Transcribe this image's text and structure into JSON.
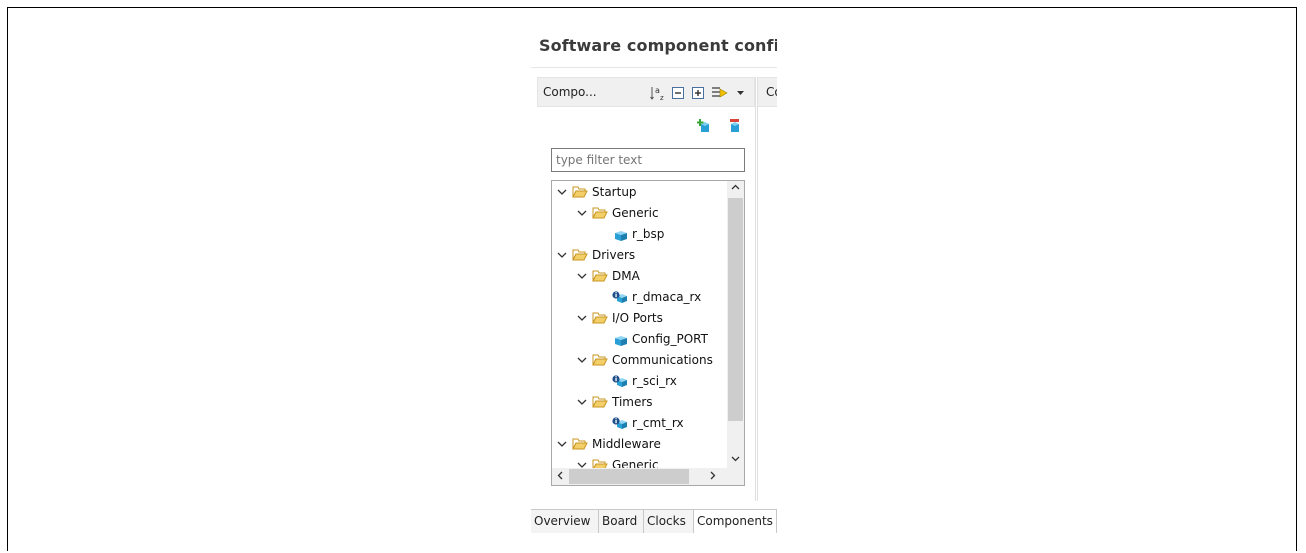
{
  "panel": {
    "title": "Software component confi",
    "left_view_title": "Compo...",
    "right_view_title": "Co"
  },
  "filter": {
    "placeholder": "type filter text",
    "value": ""
  },
  "tree": [
    {
      "label": "Startup",
      "type": "folder",
      "expanded": true
    },
    {
      "label": "Generic",
      "type": "folder",
      "expanded": true
    },
    {
      "label": "r_bsp",
      "type": "component"
    },
    {
      "label": "Drivers",
      "type": "folder",
      "expanded": true
    },
    {
      "label": "DMA",
      "type": "folder",
      "expanded": true
    },
    {
      "label": "r_dmaca_rx",
      "type": "component-info"
    },
    {
      "label": "I/O Ports",
      "type": "folder",
      "expanded": true
    },
    {
      "label": "Config_PORT",
      "type": "component"
    },
    {
      "label": "Communications",
      "type": "folder",
      "expanded": true
    },
    {
      "label": "r_sci_rx",
      "type": "component-info"
    },
    {
      "label": "Timers",
      "type": "folder",
      "expanded": true
    },
    {
      "label": "r_cmt_rx",
      "type": "component-info"
    },
    {
      "label": "Middleware",
      "type": "folder",
      "expanded": true
    },
    {
      "label": "Generic",
      "type": "folder",
      "expanded": true
    }
  ],
  "tabs": [
    "Overview",
    "Board",
    "Clocks",
    "Components"
  ],
  "active_tab": "Components",
  "toolbar_icons": [
    "sort-az-icon",
    "collapse-all-icon",
    "expand-all-icon",
    "view-mode-icon",
    "dropdown-icon"
  ],
  "colors": {
    "folder": "#e8b84a",
    "component": "#2a9fd6",
    "add": "#3aa63a",
    "remove": "#d9443a"
  }
}
